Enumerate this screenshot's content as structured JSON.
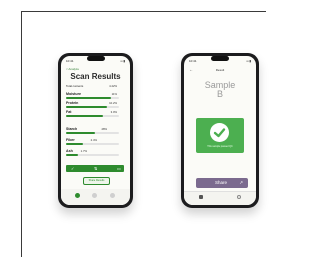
{
  "phone1": {
    "time": "10:41",
    "back_label": "< Analyze",
    "title": "Scan Results",
    "rows": [
      {
        "label": "Total contents",
        "value": "4.42%",
        "fill": 0.0
      },
      {
        "label": "Moisture",
        "value": "11%",
        "fill": 0.85
      },
      {
        "label": "Protein",
        "value": "10.2%",
        "fill": 0.78
      },
      {
        "label": "Fat",
        "value": "3.0%",
        "fill": 0.7
      },
      {
        "label": "Starch",
        "value": "48%",
        "fill": 0.55
      },
      {
        "label": "Fiber",
        "value": "2.4%",
        "fill": 0.32
      },
      {
        "label": "Ash",
        "value": "1.7%",
        "fill": 0.22
      }
    ],
    "share_label": "Share Results",
    "accent": "#2e8b2e"
  },
  "phone2": {
    "time": "10:41",
    "header": "Result",
    "sample_line1": "Sample",
    "sample_line2": "B",
    "card_text": "This sample passed QC",
    "share_label": "Share",
    "accent": "#4caf50",
    "share_color": "#7b6a8e"
  }
}
